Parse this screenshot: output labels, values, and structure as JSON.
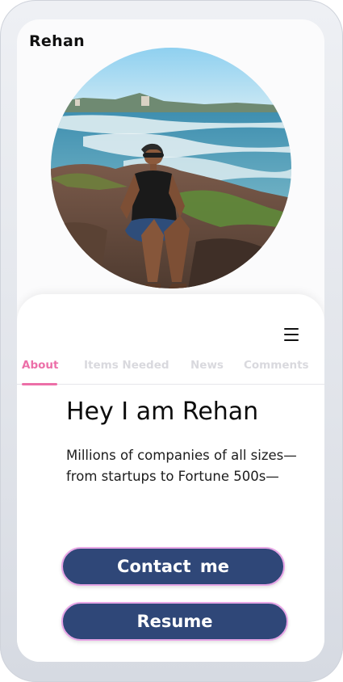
{
  "profile": {
    "username": "Rehan",
    "photo_alt": "Rehan sitting on rocks at the beach"
  },
  "menu": {
    "icon": "hamburger-menu-icon"
  },
  "tabs": [
    {
      "label": "About",
      "active": true
    },
    {
      "label": "Items Needed",
      "active": false
    },
    {
      "label": "News",
      "active": false
    },
    {
      "label": "Comments",
      "active": false
    }
  ],
  "about": {
    "heading": "Hey I am Rehan",
    "description": "Millions of companies of all sizes—from startups to Fortune 500s—"
  },
  "buttons": {
    "contact_label": "Contact  me",
    "resume_label": "Resume"
  },
  "colors": {
    "accent": "#ec6fa8",
    "button_bg": "#2f4778",
    "button_border": "#e7a6e6",
    "inactive_tab": "#d9d9de"
  }
}
